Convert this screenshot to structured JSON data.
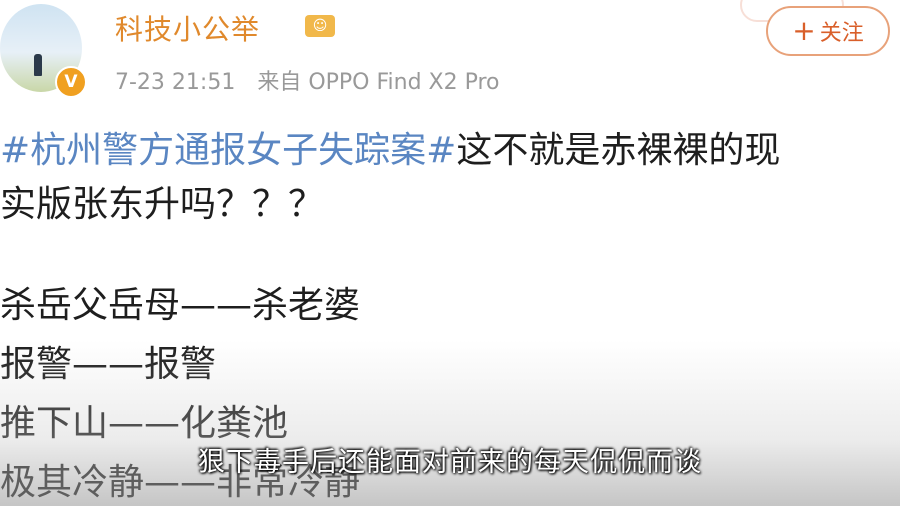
{
  "header": {
    "username": "科技小公举",
    "timestamp": "7-23 21:51",
    "source": "来自 OPPO Find X2 Pro",
    "follow_label": "关注",
    "follow_icon": "+",
    "verified_badge": "V"
  },
  "post": {
    "topic": "#杭州警方通报女子失踪案#",
    "line1_rest": "这不就是赤裸裸的现",
    "line2": "实版张东升吗？？？",
    "list": [
      "杀岳父岳母——杀老婆",
      "报警——报警",
      "推下山——化粪池",
      "极其冷静——非常冷静"
    ]
  },
  "video": {
    "subtitle": "狠下毒手后还能面对前来的每天侃侃而谈"
  },
  "colors": {
    "username": "#e0892c",
    "topic": "#5a86c2",
    "follow": "#d95f2a"
  }
}
